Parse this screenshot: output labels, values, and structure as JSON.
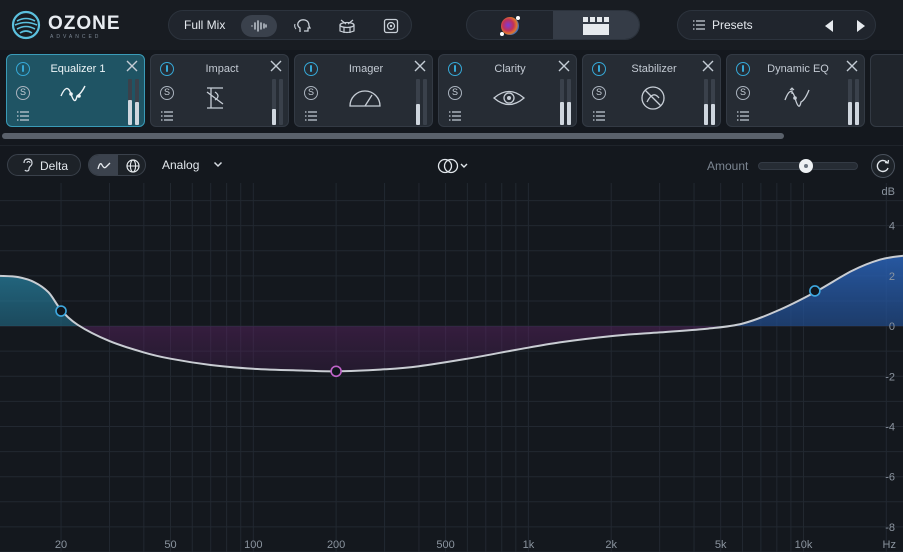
{
  "app": {
    "logo_text": "OZONE",
    "logo_subtext": "ADVANCED"
  },
  "topbar": {
    "mix_selector_label": "Full Mix",
    "mode_icons": [
      "waveform-icon",
      "vocal-head-icon",
      "drum-icon",
      "speaker-icon"
    ],
    "active_mode": "waveform-icon",
    "view_icons": [
      "assistant-orb-icon",
      "module-grid-icon"
    ],
    "active_view": "module-grid-icon",
    "presets_label": "Presets"
  },
  "modules": [
    {
      "name": "Equalizer 1",
      "icon": "eq-curve-icon",
      "selected": true,
      "meter_levels": [
        0.55,
        0.5
      ]
    },
    {
      "name": "Impact",
      "icon": "impact-icon",
      "selected": false,
      "meter_levels": [
        0.35,
        0
      ]
    },
    {
      "name": "Imager",
      "icon": "imager-icon",
      "selected": false,
      "meter_levels": [
        0.45,
        0
      ]
    },
    {
      "name": "Clarity",
      "icon": "clarity-eye-icon",
      "selected": false,
      "meter_levels": [
        0.5,
        0.5
      ]
    },
    {
      "name": "Stabilizer",
      "icon": "stabilizer-icon",
      "selected": false,
      "meter_levels": [
        0.45,
        0.45
      ]
    },
    {
      "name": "Dynamic EQ",
      "icon": "dynamic-eq-icon",
      "selected": false,
      "meter_levels": [
        0.5,
        0.5
      ]
    }
  ],
  "eq_toolbar": {
    "delta_label": "Delta",
    "view_toggle_options": [
      "curve-view-icon",
      "globe-icon"
    ],
    "active_view_toggle": "curve-view-icon",
    "mode_label": "Analog",
    "stereo_mode_icon": "stereo-link-icon",
    "amount_label": "Amount",
    "amount_value": 0.48
  },
  "eq_graph": {
    "db_unit_label": "dB",
    "hz_unit_label": "Hz",
    "db_ticks": [
      "4",
      "2",
      "0",
      "-2",
      "-4",
      "-6",
      "-8"
    ],
    "db_values": [
      4,
      2,
      0,
      -2,
      -4,
      -6,
      -8
    ],
    "db_range": [
      -9,
      5.7
    ],
    "freq_range_hz": [
      12,
      23000
    ],
    "freq_ticks": [
      "20",
      "50",
      "100",
      "200",
      "500",
      "1k",
      "2k",
      "5k",
      "10k"
    ],
    "freq_values_hz": [
      20,
      50,
      100,
      200,
      500,
      1000,
      2000,
      5000,
      10000
    ],
    "bands": [
      {
        "freq_hz": 20,
        "gain_db": 0.6,
        "color": "#3ea8e0"
      },
      {
        "freq_hz": 200,
        "gain_db": -1.8,
        "color": "#c063c9"
      },
      {
        "freq_hz": 11000,
        "gain_db": 1.4,
        "color": "#3ea8e0"
      }
    ],
    "curve_points": [
      [
        12,
        2.0
      ],
      [
        14,
        1.95
      ],
      [
        16,
        1.75
      ],
      [
        18,
        1.35
      ],
      [
        20,
        0.65
      ],
      [
        23,
        0.05
      ],
      [
        30,
        -0.6
      ],
      [
        40,
        -1.05
      ],
      [
        50,
        -1.3
      ],
      [
        70,
        -1.55
      ],
      [
        100,
        -1.7
      ],
      [
        150,
        -1.77
      ],
      [
        200,
        -1.8
      ],
      [
        300,
        -1.72
      ],
      [
        400,
        -1.6
      ],
      [
        600,
        -1.3
      ],
      [
        900,
        -0.95
      ],
      [
        1300,
        -0.65
      ],
      [
        2000,
        -0.4
      ],
      [
        3000,
        -0.25
      ],
      [
        4500,
        -0.1
      ],
      [
        6000,
        0.1
      ],
      [
        8000,
        0.6
      ],
      [
        11000,
        1.35
      ],
      [
        15000,
        2.2
      ],
      [
        19000,
        2.65
      ],
      [
        23000,
        2.8
      ]
    ],
    "colors": {
      "curve": "#c9cdd3",
      "boost_fill": "#1f6f8a",
      "cut_fill": "#8d2f8c",
      "grid": "#222831",
      "background": "#14181e"
    }
  }
}
